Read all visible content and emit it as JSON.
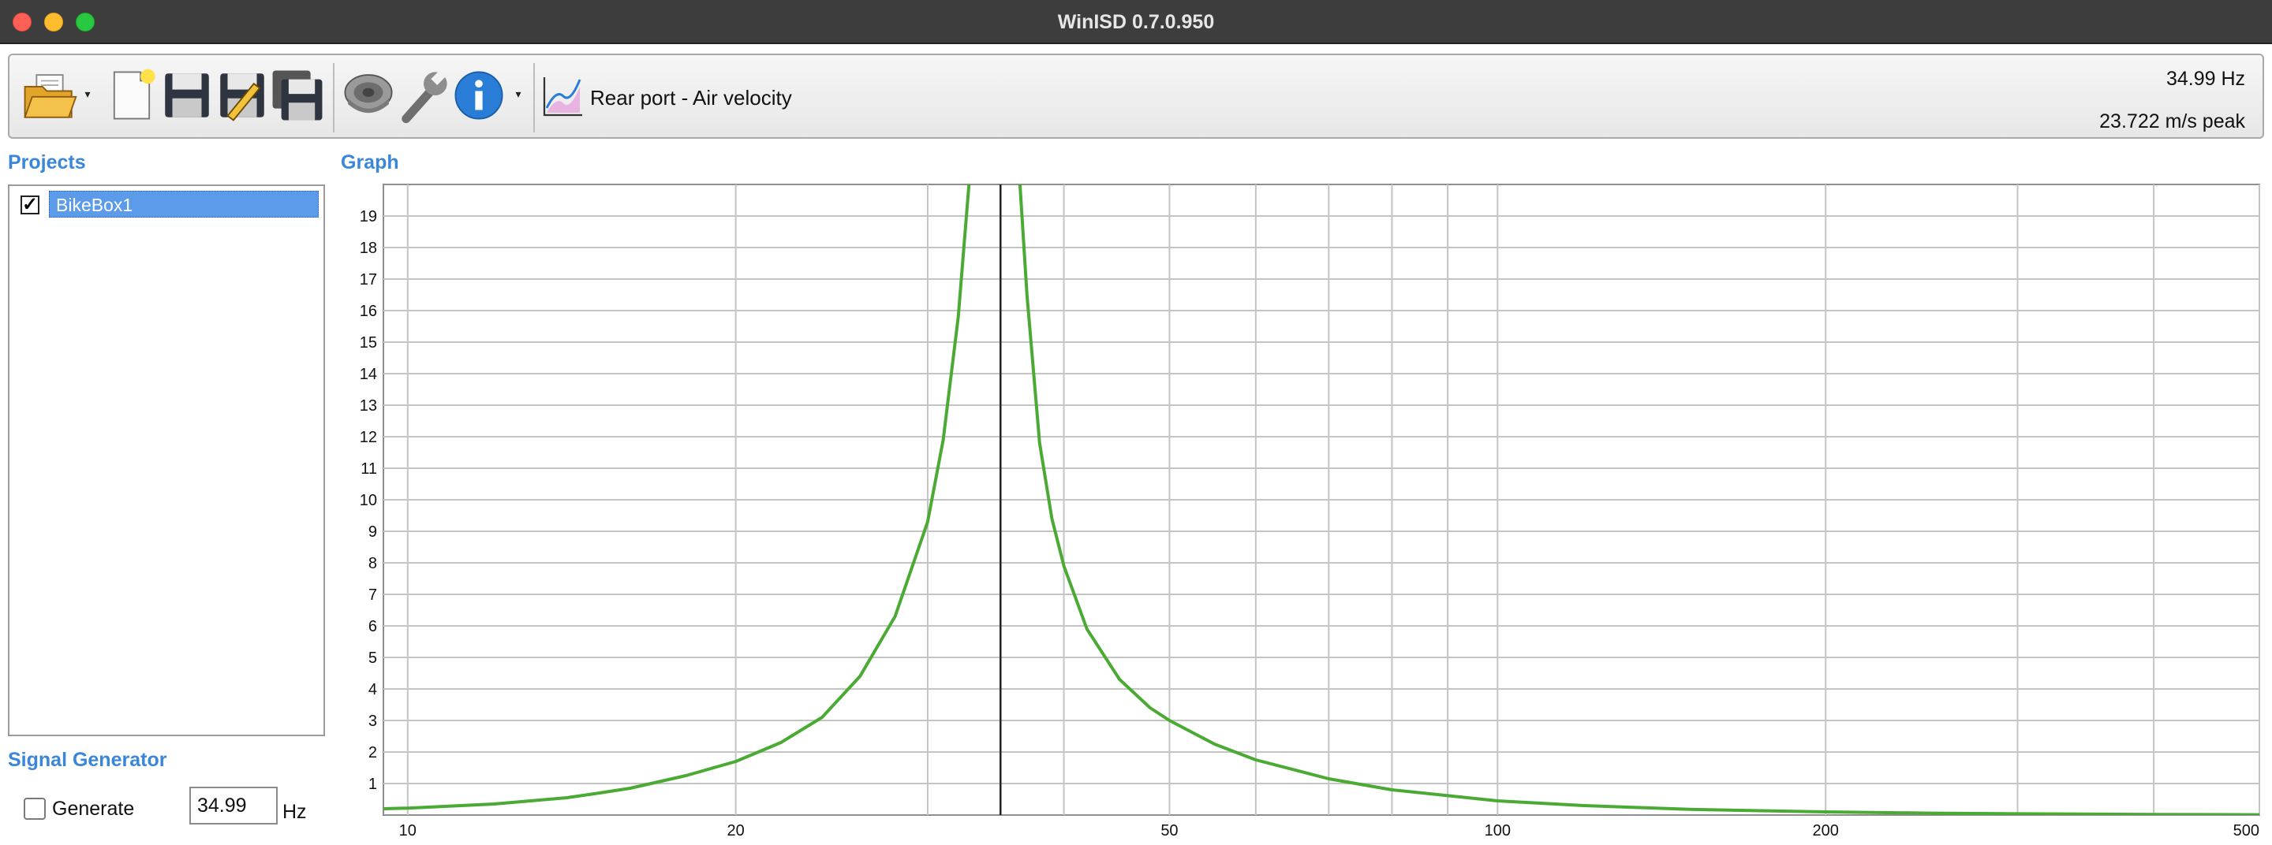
{
  "window": {
    "title": "WinISD 0.7.0.950"
  },
  "toolbar": {
    "buttons": [
      {
        "name": "open-project-icon",
        "tooltip": "Open project"
      },
      {
        "name": "new-project-icon",
        "tooltip": "New project"
      },
      {
        "name": "save-icon",
        "tooltip": "Save"
      },
      {
        "name": "save-as-icon",
        "tooltip": "Save as"
      },
      {
        "name": "save-all-icon",
        "tooltip": "Save all"
      },
      {
        "name": "driver-editor-icon",
        "tooltip": "Driver editor"
      },
      {
        "name": "tools-wrench-icon",
        "tooltip": "Tools"
      },
      {
        "name": "info-icon",
        "tooltip": "About"
      }
    ],
    "graph_view_label": "Rear port - Air velocity"
  },
  "status": {
    "frequency": "34.99 Hz",
    "value": "23.722 m/s peak"
  },
  "projects": {
    "heading": "Projects",
    "items": [
      {
        "label": "BikeBox1",
        "checked": true
      }
    ]
  },
  "graph": {
    "heading": "Graph"
  },
  "signal_generator": {
    "heading": "Signal Generator",
    "generate_label": "Generate",
    "generate_checked": false,
    "frequency_value": "34.99",
    "unit": "Hz"
  },
  "colors": {
    "curve": "#4aaa33",
    "heading": "#3a86d8",
    "selection": "#5b9bea",
    "cursor": "#222222"
  },
  "chart_data": {
    "type": "line",
    "x_scale": "log",
    "xlim": [
      9.5,
      500
    ],
    "ylim": [
      0,
      20
    ],
    "x_ticks": [
      10,
      20,
      50,
      100,
      200,
      500
    ],
    "y_ticks": [
      1,
      2,
      3,
      4,
      5,
      6,
      7,
      8,
      9,
      10,
      11,
      12,
      13,
      14,
      15,
      16,
      17,
      18,
      19
    ],
    "grid": true,
    "cursor_x": 34.99,
    "series": [
      {
        "x": [
          9.5,
          10,
          12,
          14,
          15,
          16,
          18,
          20,
          22,
          24,
          26,
          28,
          30,
          31,
          32,
          33,
          34,
          34.99,
          36,
          37,
          38,
          39,
          40,
          42,
          45,
          48,
          50,
          55,
          60,
          70,
          80,
          100,
          120,
          150,
          200,
          250,
          300,
          400,
          500
        ],
        "y": [
          0.2,
          0.22,
          0.35,
          0.55,
          0.7,
          0.85,
          1.25,
          1.7,
          2.3,
          3.1,
          4.4,
          6.3,
          9.3,
          11.9,
          15.8,
          21.5,
          24,
          23.7,
          23,
          16.5,
          11.8,
          9.4,
          7.9,
          5.9,
          4.3,
          3.4,
          3.0,
          2.25,
          1.75,
          1.15,
          0.8,
          0.45,
          0.3,
          0.18,
          0.1,
          0.06,
          0.04,
          0.02,
          0.01
        ]
      }
    ]
  }
}
